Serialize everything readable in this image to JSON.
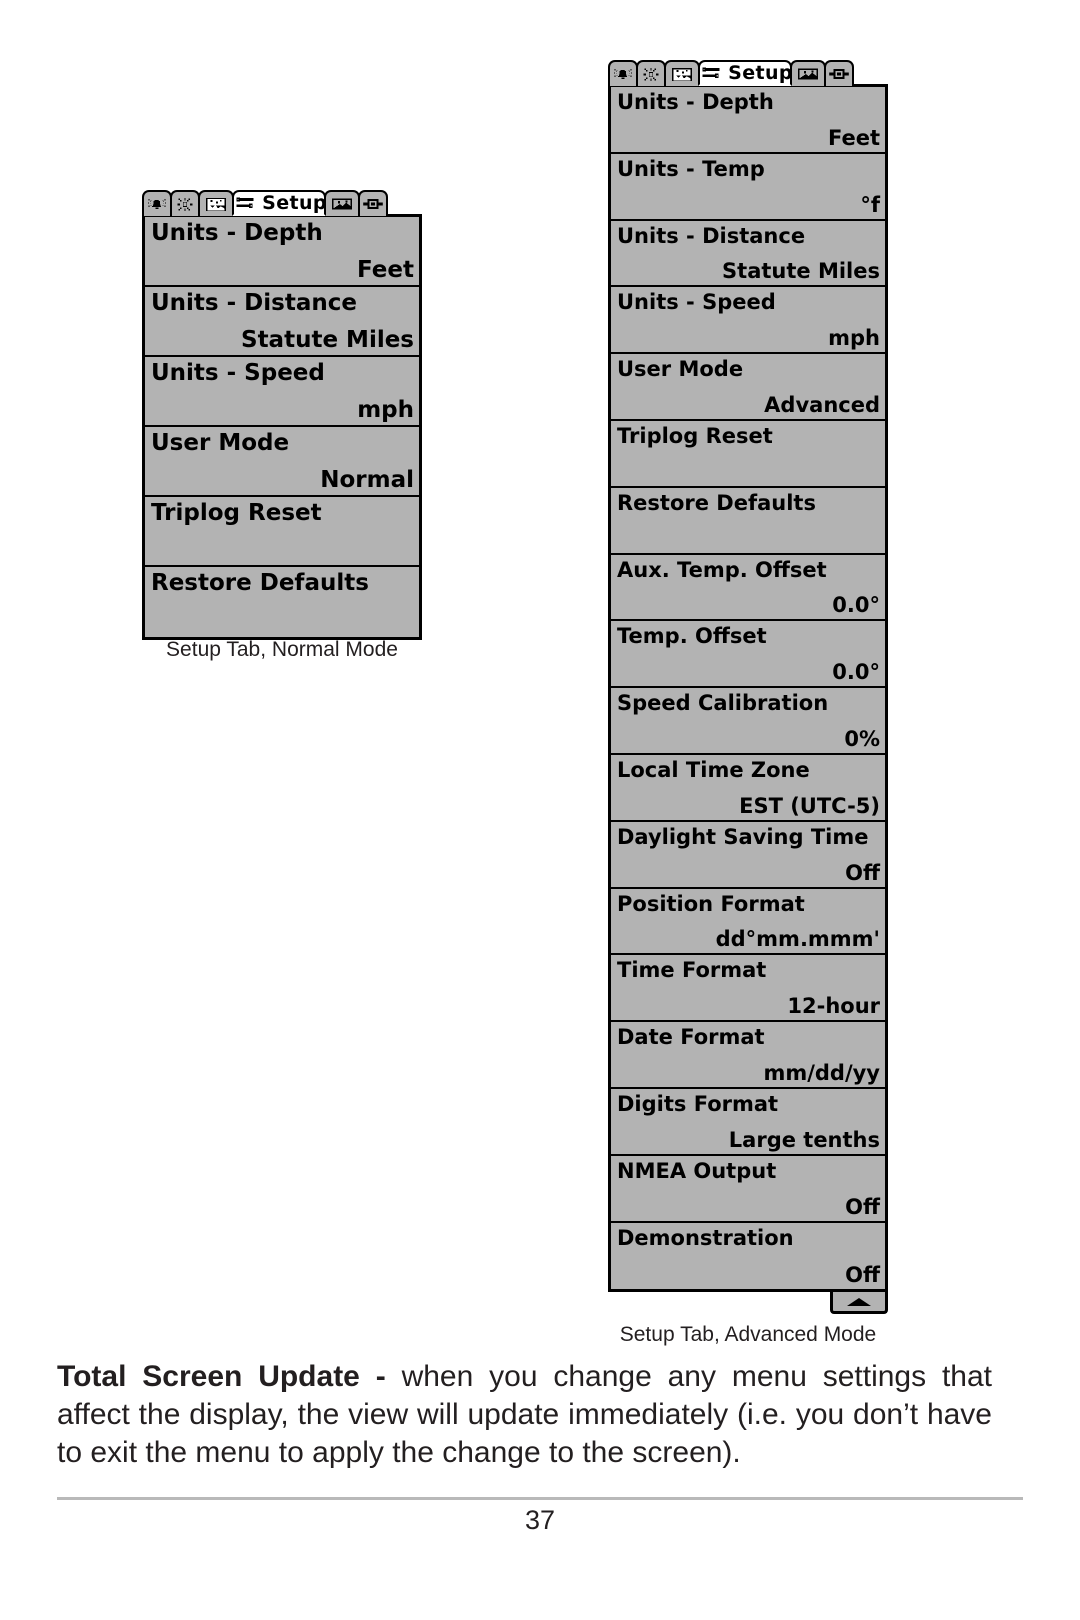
{
  "page": {
    "number": "37",
    "body_bold": "Total Screen Update -",
    "body_text": " when you change any menu settings that affect the display, the view will update immediately (i.e. you don’t have to exit the menu to apply the change to the screen)."
  },
  "tabs": {
    "icons": [
      "alarm-bell-icon",
      "sun-brightness-icon",
      "sonar-chart-icon",
      "setup-wrench-icon",
      "view-image-icon",
      "accessory-box-icon"
    ],
    "active_label": "Setup"
  },
  "normal_panel": {
    "caption": "Setup Tab, Normal Mode",
    "rows": [
      {
        "label": "Units - Depth",
        "value": "Feet"
      },
      {
        "label": "Units - Distance",
        "value": "Statute Miles"
      },
      {
        "label": "Units - Speed",
        "value": "mph"
      },
      {
        "label": "User Mode",
        "value": "Normal"
      },
      {
        "label": "Triplog Reset",
        "value": ""
      },
      {
        "label": "Restore Defaults",
        "value": ""
      }
    ]
  },
  "advanced_panel": {
    "caption": "Setup Tab, Advanced Mode",
    "scroll_icon": "scroll-up-arrow-icon",
    "rows": [
      {
        "label": "Units - Depth",
        "value": "Feet"
      },
      {
        "label": "Units - Temp",
        "value": "°f"
      },
      {
        "label": "Units - Distance",
        "value": "Statute Miles"
      },
      {
        "label": "Units - Speed",
        "value": "mph"
      },
      {
        "label": "User Mode",
        "value": "Advanced"
      },
      {
        "label": "Triplog Reset",
        "value": ""
      },
      {
        "label": "Restore Defaults",
        "value": ""
      },
      {
        "label": "Aux. Temp. Offset",
        "value": "0.0°"
      },
      {
        "label": "Temp. Offset",
        "value": "0.0°"
      },
      {
        "label": "Speed Calibration",
        "value": "0%"
      },
      {
        "label": "Local Time Zone",
        "value": "EST (UTC-5)"
      },
      {
        "label": "Daylight Saving Time",
        "value": "Off"
      },
      {
        "label": "Position Format",
        "value": "dd°mm.mmm'"
      },
      {
        "label": "Time Format",
        "value": "12-hour"
      },
      {
        "label": "Date Format",
        "value": "mm/dd/yy"
      },
      {
        "label": "Digits Format",
        "value": "Large tenths"
      },
      {
        "label": "NMEA Output",
        "value": "Off"
      },
      {
        "label": "Demonstration",
        "value": "Off"
      }
    ]
  },
  "colors": {
    "lcd_background": "#b3b3b3",
    "lcd_border": "#000000",
    "active_tab": "#ffffff",
    "text": "#231f20"
  }
}
